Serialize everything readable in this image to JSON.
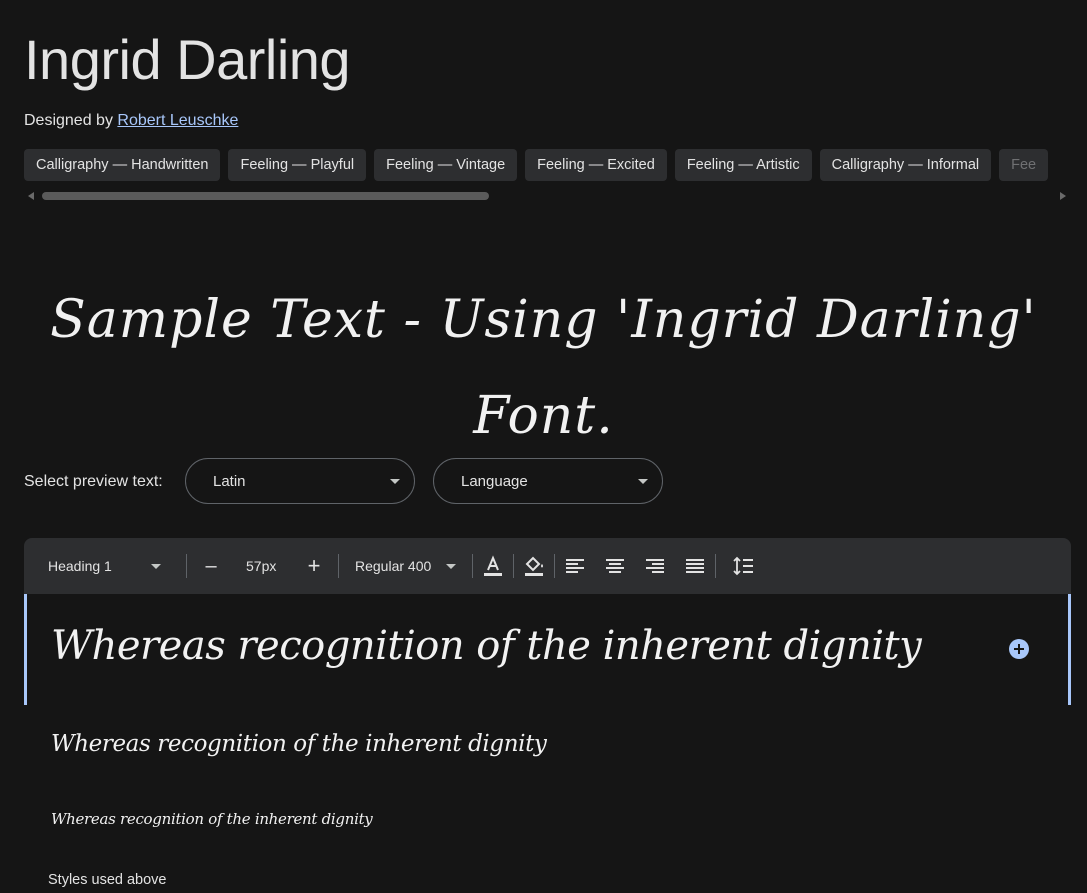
{
  "font": {
    "title": "Ingrid Darling",
    "designed_by_prefix": "Designed by",
    "designer_name": "Robert Leuschke"
  },
  "tags": [
    "Calligraphy — Handwritten",
    "Feeling — Playful",
    "Feeling — Vintage",
    "Feeling — Excited",
    "Feeling — Artistic",
    "Calligraphy — Informal",
    "Fee"
  ],
  "sample_text": "Sample Text - Using 'Ingrid Darling' Font.",
  "preview": {
    "label": "Select preview text:",
    "script_value": "Latin",
    "language_value": "Language"
  },
  "toolbar": {
    "style_value": "Heading 1",
    "decrease_symbol": "–",
    "size_value": "57px",
    "increase_symbol": "+",
    "weight_value": "Regular 400"
  },
  "preview_lines": [
    "Whereas recognition of the inherent dignity",
    "Whereas recognition of the inherent dignity",
    "Whereas recognition of the inherent dignity"
  ],
  "styles_used_label": "Styles used above",
  "colors": {
    "background": "#151515",
    "surface": "#2d2e30",
    "accent": "#a8c7fa",
    "text": "#e3e3e3"
  }
}
